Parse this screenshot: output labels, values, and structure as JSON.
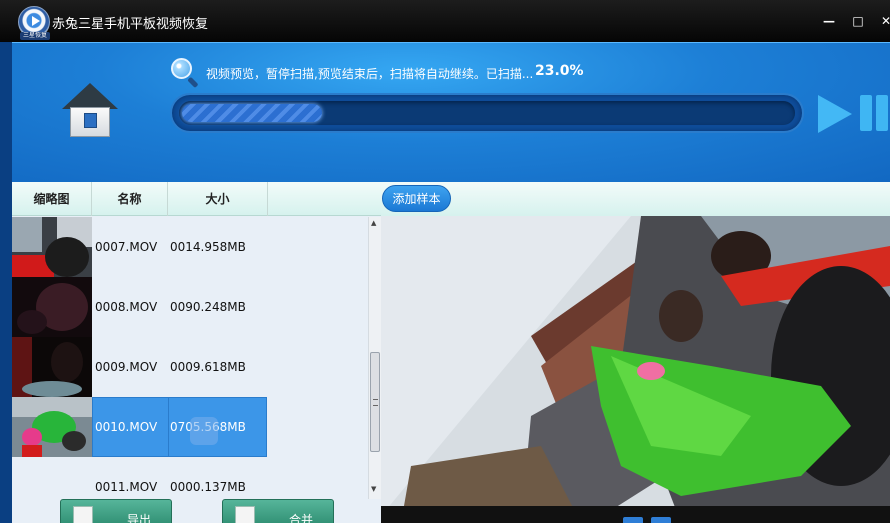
{
  "window": {
    "title": "赤兔三星手机平板视频恢复",
    "logo_text": "三星恢复",
    "minimize": "—",
    "maximize": "□",
    "close": "✕"
  },
  "scan": {
    "status_text": "视频预览，暂停扫描,预览结束后，扫描将自动继续。已扫描...",
    "percent_text": "23.0%",
    "progress_fraction": 0.23
  },
  "list": {
    "columns": [
      "缩略图",
      "名称",
      "大小"
    ],
    "rows": [
      {
        "name": "0007.MOV",
        "size": "0014.958MB",
        "selected": false
      },
      {
        "name": "0008.MOV",
        "size": "0090.248MB",
        "selected": false
      },
      {
        "name": "0009.MOV",
        "size": "0009.618MB",
        "selected": false
      },
      {
        "name": "0010.MOV",
        "size": "0705.568MB",
        "selected": true
      },
      {
        "name": "0011.MOV",
        "size": "0000.137MB",
        "selected": false
      }
    ]
  },
  "buttons": {
    "export_label": "导出",
    "merge_label": "合并",
    "add_sample_label": "添加样本"
  },
  "icons": {
    "app_logo": "play-disc-icon",
    "home": "home-icon",
    "search": "magnifier-icon",
    "play": "play-icon",
    "pause": "pause-icon",
    "export": "export-icon",
    "merge": "merge-icon"
  },
  "colors": {
    "header_blue": "#1d7fd6",
    "selection_blue": "#3c96e8",
    "button_green": "#3fa083",
    "table_header_mint": "#d6f2ee"
  }
}
